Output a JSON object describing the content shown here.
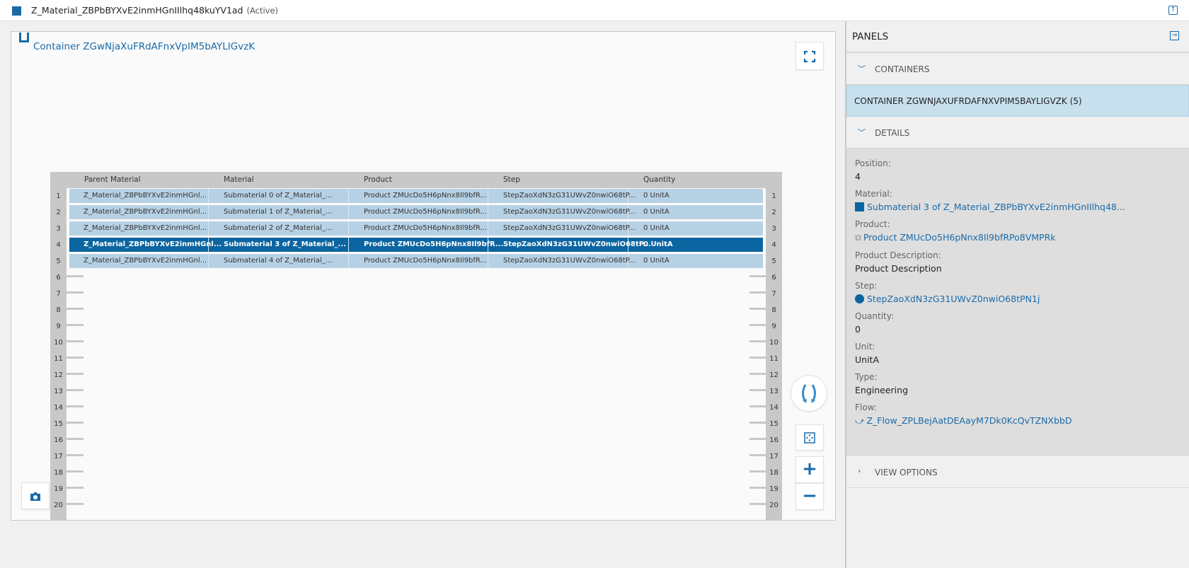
{
  "header": {
    "title": "Z_Material_ZBPbBYXvE2inmHGnIIlhq48kuYV1ad",
    "state": "(Active)"
  },
  "canvas": {
    "container_title": "Container ZGwNjaXuFRdAFnxVpIM5bAYLIGvzK"
  },
  "grid": {
    "columns": [
      "Parent Material",
      "Material",
      "Product",
      "Step",
      "Quantity"
    ],
    "row_count": 20,
    "selected_row": 4,
    "rows": [
      [
        "Z_Material_ZBPbBYXvE2inmHGnl...",
        "Submaterial 0 of Z_Material_...",
        "Product ZMUcDo5H6pNnx8Il9bfR...",
        "StepZaoXdN3zG31UWvZ0nwiO68tP...",
        "0 UnitA"
      ],
      [
        "Z_Material_ZBPbBYXvE2inmHGnl...",
        "Submaterial 1 of Z_Material_...",
        "Product ZMUcDo5H6pNnx8Il9bfR...",
        "StepZaoXdN3zG31UWvZ0nwiO68tP...",
        "0 UnitA"
      ],
      [
        "Z_Material_ZBPbBYXvE2inmHGnl...",
        "Submaterial 2 of Z_Material_...",
        "Product ZMUcDo5H6pNnx8Il9bfR...",
        "StepZaoXdN3zG31UWvZ0nwiO68tP...",
        "0 UnitA"
      ],
      [
        "Z_Material_ZBPbBYXvE2inmHGnl...",
        "Submaterial 3 of Z_Material_...",
        "Product ZMUcDo5H6pNnx8Il9bfR...",
        "StepZaoXdN3zG31UWvZ0nwiO68tP...",
        "0 UnitA"
      ],
      [
        "Z_Material_ZBPbBYXvE2inmHGnl...",
        "Submaterial 4 of Z_Material_...",
        "Product ZMUcDo5H6pNnx8Il9bfR...",
        "StepZaoXdN3zG31UWvZ0nwiO68tP...",
        "0 UnitA"
      ]
    ]
  },
  "panel": {
    "title": "PANELS",
    "containers_label": "CONTAINERS",
    "container_item": "CONTAINER ZGWNJAXUFRDAFNXVPIM5BAYLIGVZK (5)",
    "details_label": "DETAILS",
    "view_options_label": "VIEW OPTIONS",
    "details": {
      "position_label": "Position:",
      "position": "4",
      "material_label": "Material:",
      "material": "Submaterial 3 of Z_Material_ZBPbBYXvE2inmHGnIIlhq48...",
      "product_label": "Product:",
      "product": "Product ZMUcDo5H6pNnx8Il9bfRPo8VMPRk",
      "product_description_label": "Product Description:",
      "product_description": "Product Description",
      "step_label": "Step:",
      "step": "StepZaoXdN3zG31UWvZ0nwiO68tPN1j",
      "quantity_label": "Quantity:",
      "quantity": "0",
      "unit_label": "Unit:",
      "unit": "UnitA",
      "type_label": "Type:",
      "type": "Engineering",
      "flow_label": "Flow:",
      "flow": "Z_Flow_ZPLBejAatDEAayM7Dk0KcQvTZNXbbD"
    }
  },
  "colors": {
    "accent": "#1a6aa8",
    "row": "#b7d1e4",
    "row_selected": "#0b65a0",
    "container_selected": "#c8e0ee"
  }
}
